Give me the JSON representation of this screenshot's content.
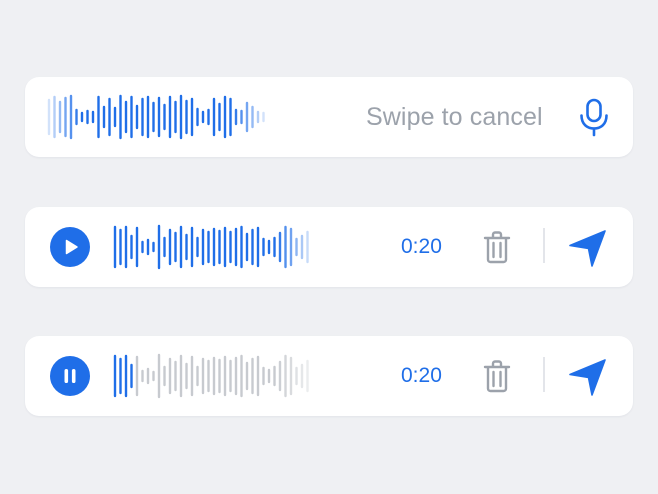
{
  "colors": {
    "accent": "#1f6ee8",
    "muted_gray": "#9ca2ab",
    "wave_inactive": "#c7cacf",
    "background": "#eff0f3",
    "card": "#ffffff"
  },
  "recording": {
    "hint": "Swipe to cancel",
    "icon": "microphone-icon"
  },
  "message_paused": {
    "control_icon": "play-icon",
    "duration": "0:20",
    "delete_icon": "trash-icon",
    "send_icon": "send-icon"
  },
  "message_playing": {
    "control_icon": "pause-icon",
    "duration": "0:20",
    "delete_icon": "trash-icon",
    "send_icon": "send-icon",
    "played_fraction": 0.12
  }
}
